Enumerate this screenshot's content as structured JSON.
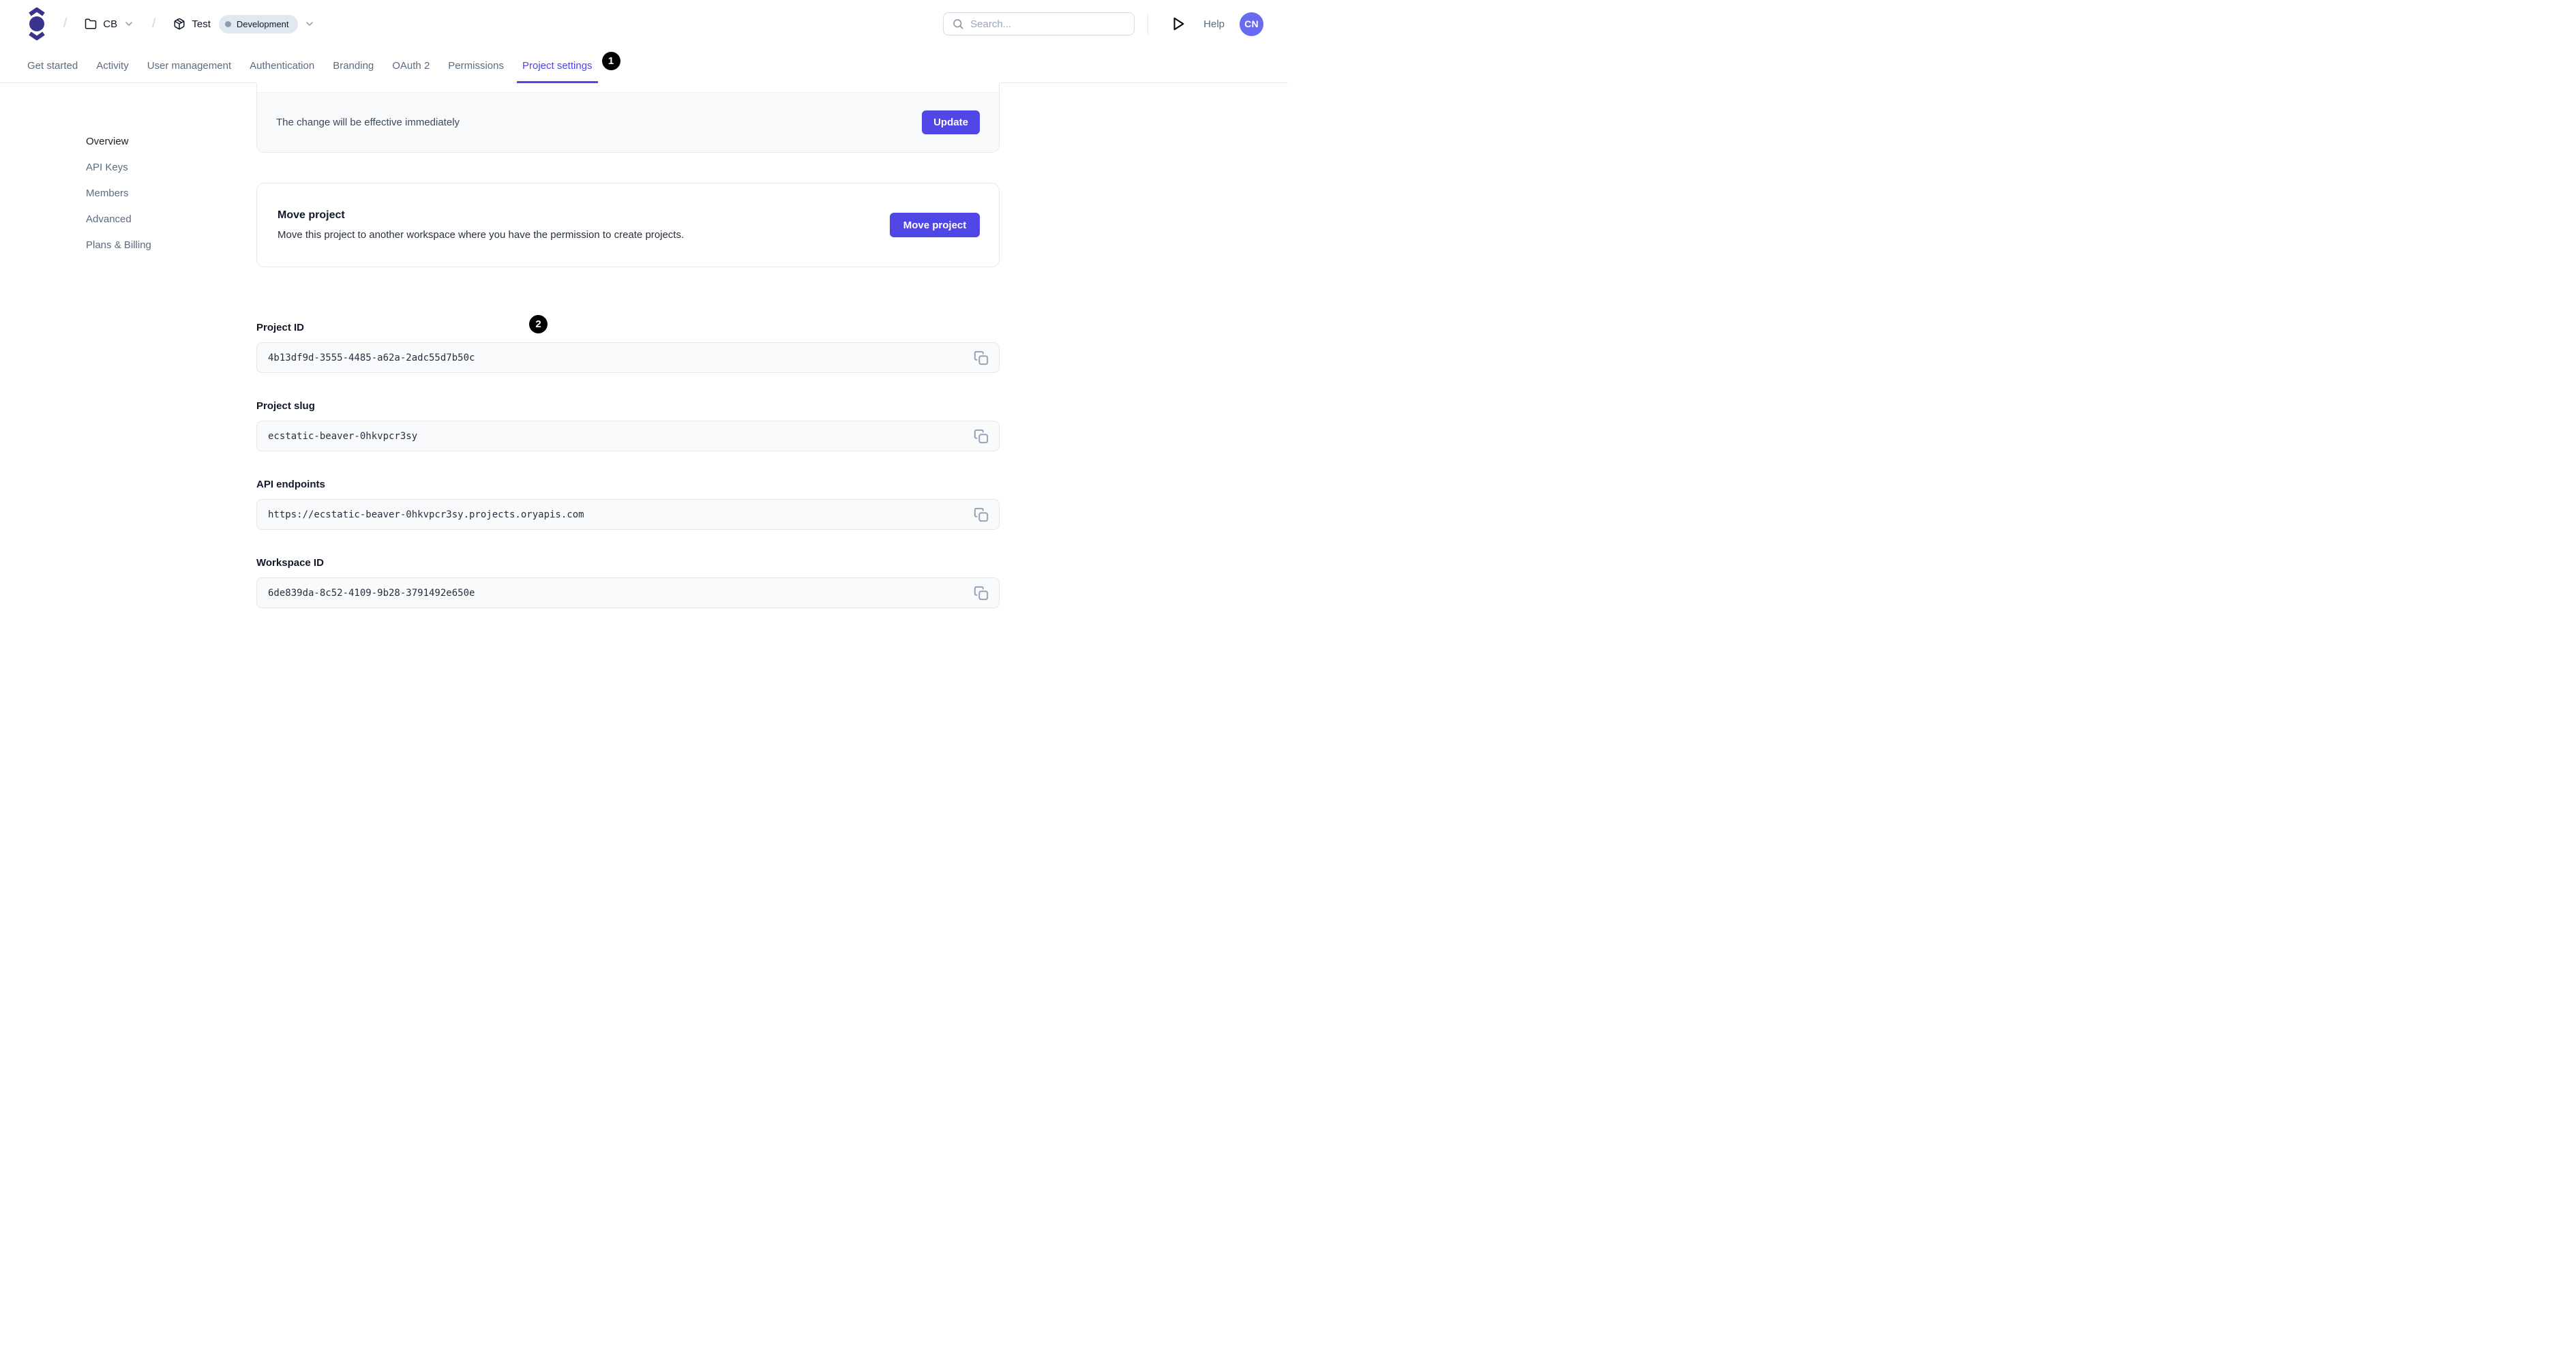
{
  "header": {
    "breadcrumb": {
      "separator": "/",
      "workspace_label": "CB",
      "project_label": "Test",
      "environment_badge": "Development"
    },
    "search": {
      "placeholder": "Search..."
    },
    "help_label": "Help",
    "avatar_initials": "CN"
  },
  "tabs": [
    {
      "label": "Get started",
      "active": false
    },
    {
      "label": "Activity",
      "active": false
    },
    {
      "label": "User management",
      "active": false
    },
    {
      "label": "Authentication",
      "active": false
    },
    {
      "label": "Branding",
      "active": false
    },
    {
      "label": "OAuth 2",
      "active": false
    },
    {
      "label": "Permissions",
      "active": false
    },
    {
      "label": "Project settings",
      "active": true
    }
  ],
  "annotations": {
    "tab_badge": "1",
    "section_badge": "2"
  },
  "sidebar": {
    "items": [
      {
        "label": "Overview",
        "active": true
      },
      {
        "label": "API Keys",
        "active": false
      },
      {
        "label": "Members",
        "active": false
      },
      {
        "label": "Advanced",
        "active": false
      },
      {
        "label": "Plans & Billing",
        "active": false
      }
    ]
  },
  "main": {
    "update_card": {
      "note": "The change will be effective immediately",
      "button_label": "Update"
    },
    "move_card": {
      "title": "Move project",
      "description": "Move this project to another workspace where you have the permission to create projects.",
      "button_label": "Move project"
    },
    "fields": [
      {
        "label": "Project ID",
        "value": "4b13df9d-3555-4485-a62a-2adc55d7b50c"
      },
      {
        "label": "Project slug",
        "value": "ecstatic-beaver-0hkvpcr3sy"
      },
      {
        "label": "API endpoints",
        "value": "https://ecstatic-beaver-0hkvpcr3sy.projects.oryapis.com"
      },
      {
        "label": "Workspace ID",
        "value": "6de839da-8c52-4109-9b28-3791492e650e"
      }
    ]
  },
  "colors": {
    "accent": "#4f46e5",
    "logo": "#38338c",
    "avatar_bg": "#686aef",
    "badge_bg": "#e2e8f0",
    "field_bg": "#f8fafc",
    "border": "#e4e9f0",
    "muted_text": "#5b6b81"
  }
}
